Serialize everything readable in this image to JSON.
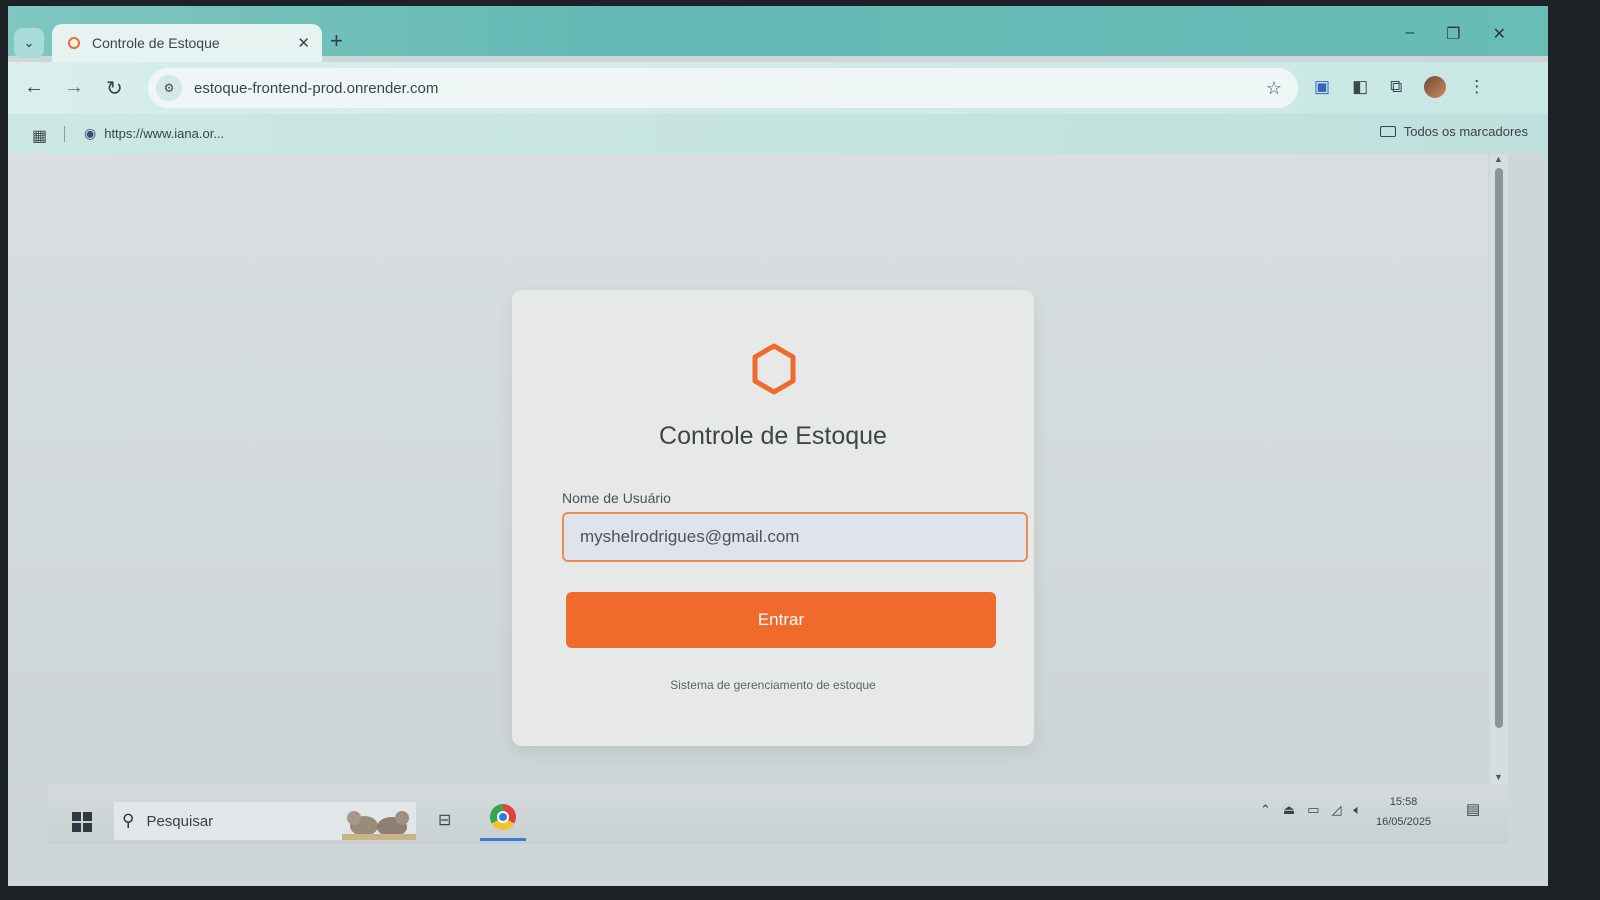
{
  "browser": {
    "tab_title": "Controle de Estoque",
    "tab_close": "✕",
    "new_tab": "+",
    "url": "estoque-frontend-prod.onrender.com",
    "bookmark_url": "https://www.iana.or...",
    "all_bookmarks": "Todos os marcadores"
  },
  "login": {
    "title": "Controle de Estoque",
    "username_label": "Nome de Usuário",
    "username_value": "myshelrodrigues@gmail.com",
    "submit_label": "Entrar",
    "footer": "Sistema de gerenciamento de estoque"
  },
  "taskbar": {
    "search_placeholder": "Pesquisar",
    "time": "15:58",
    "date": "16/05/2025"
  },
  "colors": {
    "accent": "#ef6a2b",
    "tabstrip": "#63b8b3"
  },
  "icons": [
    "tab-search-icon",
    "back-icon",
    "forward-icon",
    "reload-icon",
    "site-info-icon",
    "star-icon",
    "translate-icon",
    "reading-list-icon",
    "extensions-icon",
    "avatar",
    "menu-icon",
    "apps-icon",
    "folder-icon",
    "hexagon-logo-icon",
    "windows-start-icon",
    "search-icon",
    "task-view-icon",
    "chrome-icon",
    "chevron-up-icon",
    "notification-icon"
  ]
}
